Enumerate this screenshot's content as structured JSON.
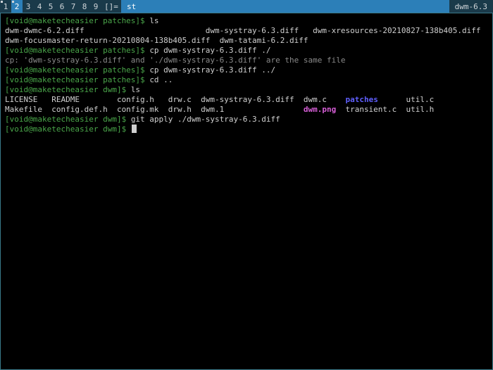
{
  "statusbar": {
    "tags": [
      "1",
      "2",
      "3",
      "4",
      "5",
      "6",
      "7",
      "8",
      "9"
    ],
    "selected_tag_index": 1,
    "indicator_tags": [
      0,
      1
    ],
    "layout_symbol": "[]=",
    "title": "st",
    "right": "dwm-6.3"
  },
  "term": {
    "lines": [
      {
        "segs": [
          {
            "cls": "g",
            "t": "[void@maketecheasier patches]$ "
          },
          {
            "cls": "w",
            "t": "ls"
          }
        ]
      },
      {
        "segs": [
          {
            "cls": "w",
            "t": "dwm-dwmc-6.2.diff                          dwm-systray-6.3.diff   dwm-xresources-20210827-138b405.diff"
          }
        ]
      },
      {
        "segs": [
          {
            "cls": "w",
            "t": "dwm-focusmaster-return-20210804-138b405.diff  dwm-tatami-6.2.diff"
          }
        ]
      },
      {
        "segs": [
          {
            "cls": "g",
            "t": "[void@maketecheasier patches]$ "
          },
          {
            "cls": "w",
            "t": "cp dwm-systray-6.3.diff ./"
          }
        ]
      },
      {
        "segs": [
          {
            "cls": "dim",
            "t": "cp: 'dwm-systray-6.3.diff' and './dwm-systray-6.3.diff' are the same file"
          }
        ]
      },
      {
        "segs": [
          {
            "cls": "g",
            "t": "[void@maketecheasier patches]$ "
          },
          {
            "cls": "w",
            "t": "cp dwm-systray-6.3.diff ../"
          }
        ]
      },
      {
        "segs": [
          {
            "cls": "g",
            "t": "[void@maketecheasier patches]$ "
          },
          {
            "cls": "w",
            "t": "cd .."
          }
        ]
      },
      {
        "segs": [
          {
            "cls": "g",
            "t": "[void@maketecheasier dwm]$ "
          },
          {
            "cls": "w",
            "t": "ls"
          }
        ]
      },
      {
        "segs": [
          {
            "cls": "w",
            "t": "LICENSE   README        config.h   drw.c  dwm-systray-6.3.diff  dwm.c    "
          },
          {
            "cls": "blue",
            "t": "patches"
          },
          {
            "cls": "w",
            "t": "      util.c"
          }
        ]
      },
      {
        "segs": [
          {
            "cls": "w",
            "t": "Makefile  config.def.h  config.mk  drw.h  dwm.1                 "
          },
          {
            "cls": "mag",
            "t": "dwm.png"
          },
          {
            "cls": "w",
            "t": "  transient.c  util.h"
          }
        ]
      },
      {
        "segs": [
          {
            "cls": "g",
            "t": "[void@maketecheasier dwm]$ "
          },
          {
            "cls": "w",
            "t": "git apply ./dwm-systray-6.3.diff"
          }
        ]
      },
      {
        "segs": [
          {
            "cls": "g",
            "t": "[void@maketecheasier dwm]$ "
          },
          {
            "cls": "w",
            "t": ""
          },
          {
            "cursor": true
          }
        ]
      }
    ]
  }
}
